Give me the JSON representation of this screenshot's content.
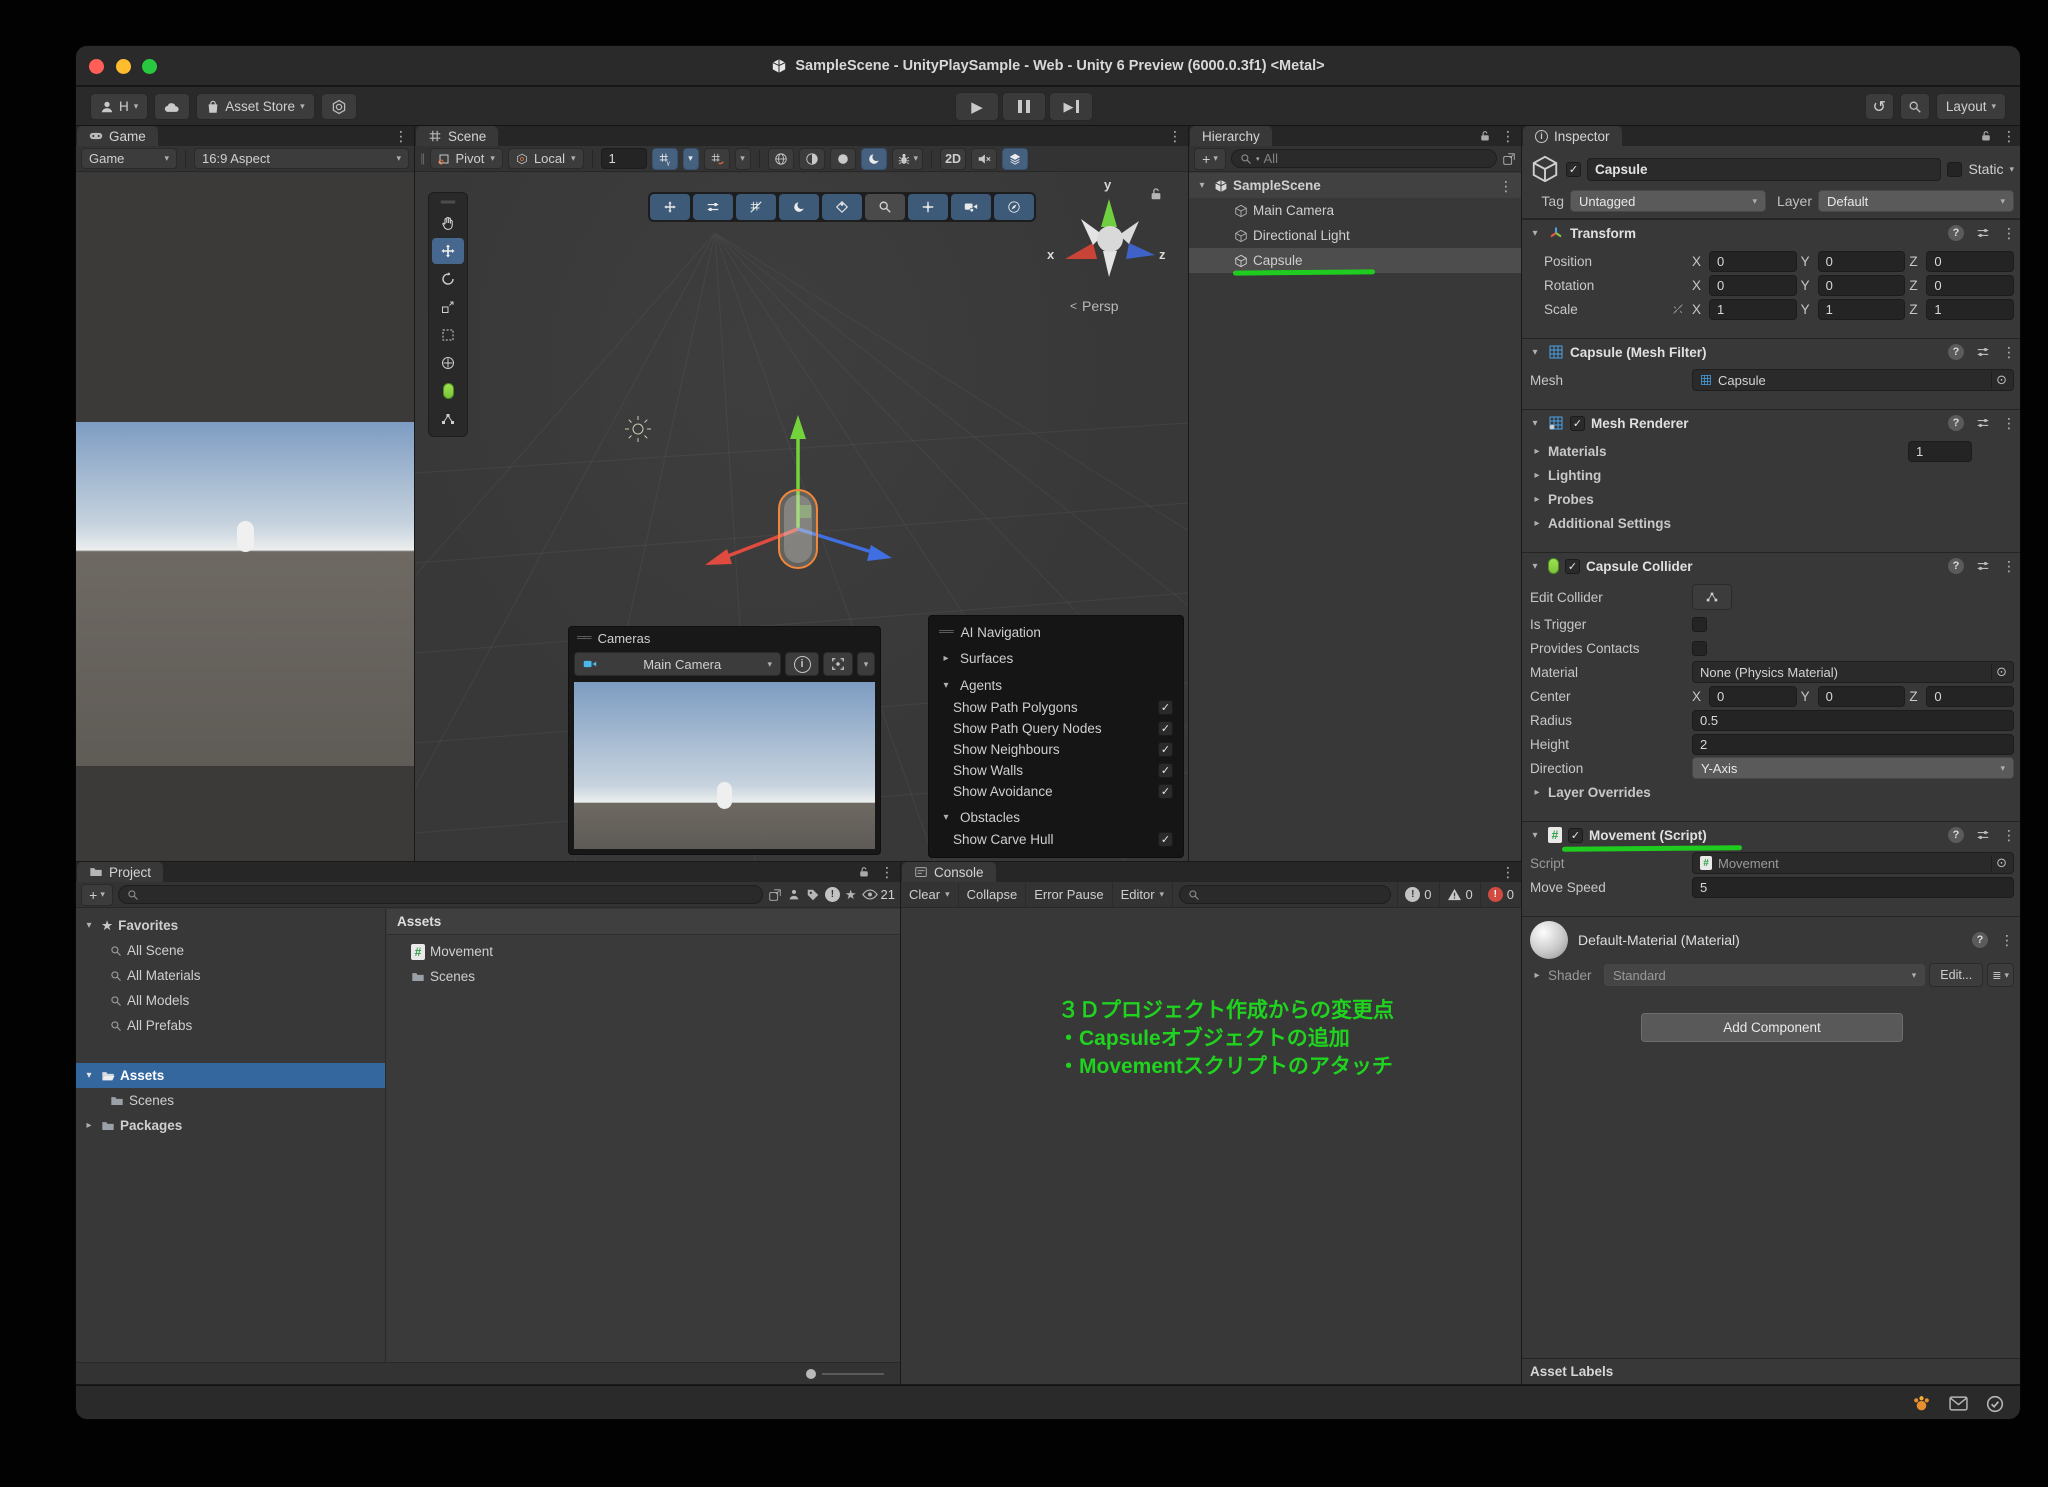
{
  "window": {
    "title": "SampleScene - UnityPlaySample - Web - Unity 6 Preview (6000.0.3f1) <Metal>"
  },
  "toolbar": {
    "account": "H",
    "asset_store": "Asset Store",
    "layout": "Layout"
  },
  "game": {
    "tab": "Game",
    "display": "Game",
    "aspect": "16:9 Aspect"
  },
  "scene": {
    "tab": "Scene",
    "pivot": "Pivot",
    "orientation": "Local",
    "grid_size": "1",
    "mode_2d": "2D",
    "persp": "Persp",
    "axis_x": "x",
    "axis_y": "y",
    "axis_z": "z"
  },
  "cameras_overlay": {
    "title": "Cameras",
    "camera": "Main Camera"
  },
  "ai_navigation": {
    "title": "AI Navigation",
    "surfaces": "Surfaces",
    "agents": "Agents",
    "agent_options": [
      "Show Path Polygons",
      "Show Path Query Nodes",
      "Show Neighbours",
      "Show Walls",
      "Show Avoidance"
    ],
    "obstacles": "Obstacles",
    "carve": "Show Carve Hull"
  },
  "hierarchy": {
    "tab": "Hierarchy",
    "search_placeholder": "All",
    "scene_name": "SampleScene",
    "items": [
      "Main Camera",
      "Directional Light",
      "Capsule"
    ]
  },
  "inspector": {
    "tab": "Inspector",
    "name": "Capsule",
    "static": "Static",
    "tag_label": "Tag",
    "tag": "Untagged",
    "layer_label": "Layer",
    "layer": "Default",
    "axis": {
      "x": "X",
      "y": "Y",
      "z": "Z"
    },
    "transform": {
      "title": "Transform",
      "position_label": "Position",
      "rotation_label": "Rotation",
      "scale_label": "Scale",
      "position": {
        "x": "0",
        "y": "0",
        "z": "0"
      },
      "rotation": {
        "x": "0",
        "y": "0",
        "z": "0"
      },
      "scale": {
        "x": "1",
        "y": "1",
        "z": "1"
      }
    },
    "mesh_filter": {
      "title": "Capsule (Mesh Filter)",
      "mesh_label": "Mesh",
      "mesh": "Capsule"
    },
    "mesh_renderer": {
      "title": "Mesh Renderer",
      "materials_label": "Materials",
      "materials_count": "1",
      "lighting": "Lighting",
      "probes": "Probes",
      "additional": "Additional Settings"
    },
    "collider": {
      "title": "Capsule Collider",
      "edit_label": "Edit Collider",
      "is_trigger": "Is Trigger",
      "provides_contacts": "Provides Contacts",
      "material_label": "Material",
      "material": "None (Physics Material)",
      "center_label": "Center",
      "center": {
        "x": "0",
        "y": "0",
        "z": "0"
      },
      "radius_label": "Radius",
      "radius": "0.5",
      "height_label": "Height",
      "height": "2",
      "direction_label": "Direction",
      "direction": "Y-Axis",
      "layer_overrides": "Layer Overrides"
    },
    "movement": {
      "title": "Movement (Script)",
      "script_label": "Script",
      "script": "Movement",
      "speed_label": "Move Speed",
      "speed": "5"
    },
    "material": {
      "title": "Default-Material (Material)",
      "shader_label": "Shader",
      "shader": "Standard",
      "edit": "Edit..."
    },
    "add_component": "Add Component",
    "asset_labels": "Asset Labels"
  },
  "project": {
    "tab": "Project",
    "favorites": "Favorites",
    "favorite_items": [
      "All Scene",
      "All Materials",
      "All Models",
      "All Prefabs"
    ],
    "assets": "Assets",
    "assets_child": "Scenes",
    "packages": "Packages",
    "pane_title": "Assets",
    "item_script": "Movement",
    "item_folder": "Scenes",
    "visible_count": "21"
  },
  "console": {
    "tab": "Console",
    "clear": "Clear",
    "collapse": "Collapse",
    "error_pause": "Error Pause",
    "editor": "Editor",
    "info_count": "0",
    "warn_count": "0",
    "error_count": "0"
  },
  "annotation": {
    "line1": "３Ｄプロジェクト作成からの変更点",
    "line2": "・Capsuleオブジェクトの追加",
    "line3": "・Movementスクリプトのアタッチ",
    "color": "#1fd31f"
  }
}
